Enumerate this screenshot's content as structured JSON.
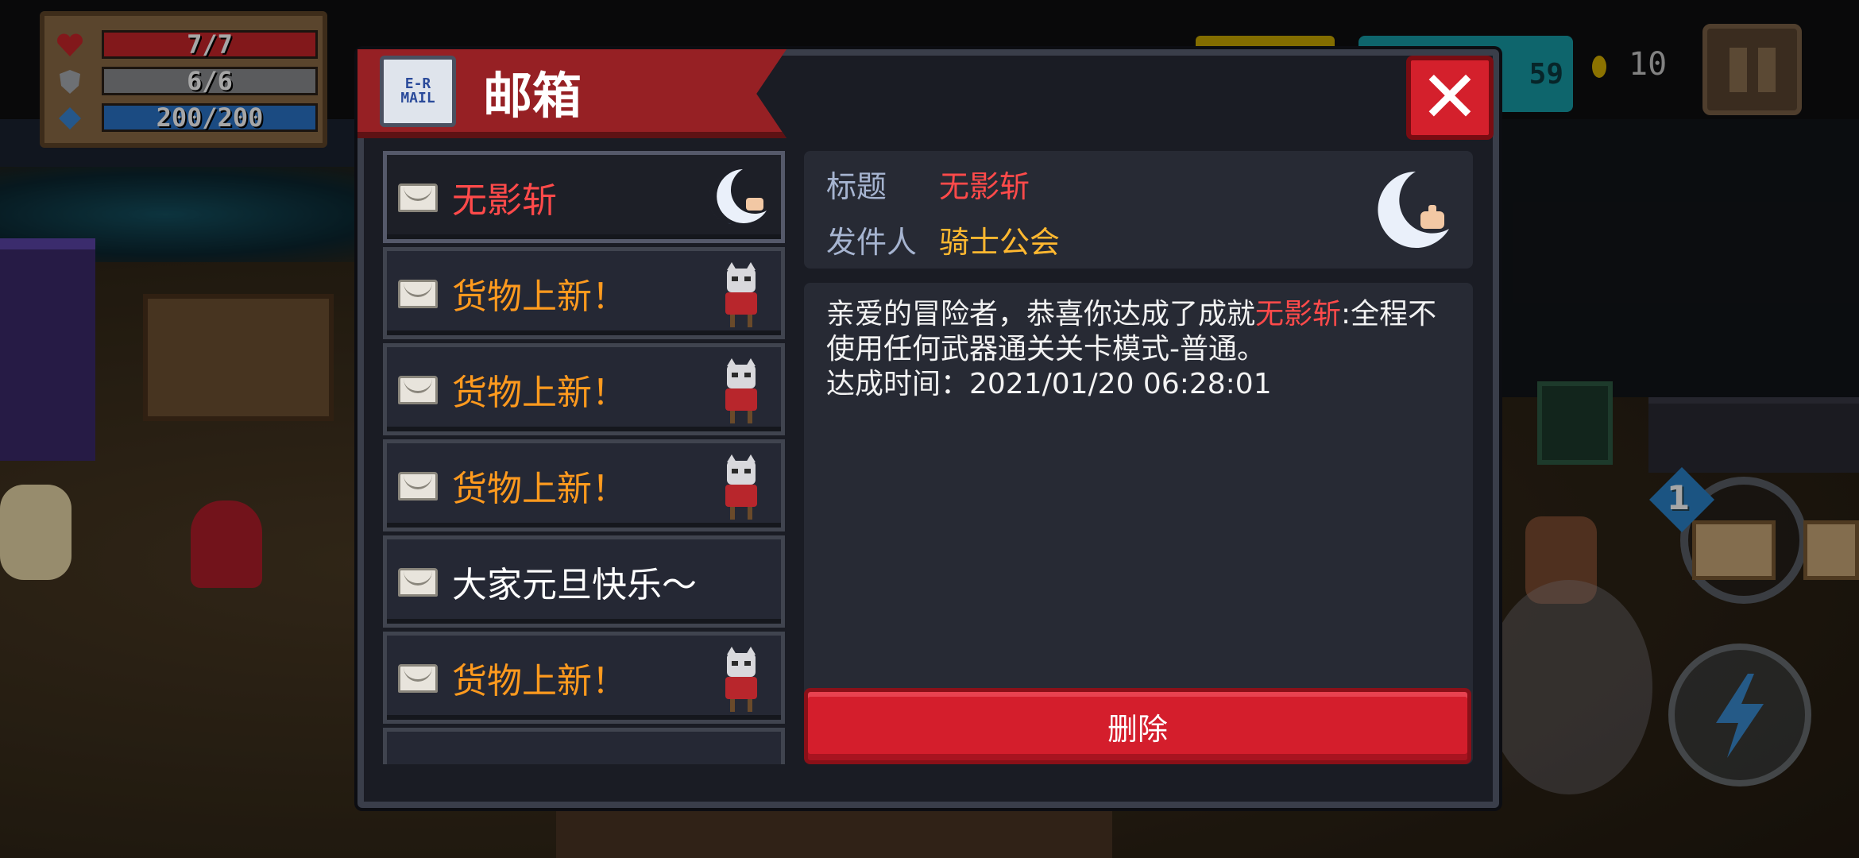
{
  "hud": {
    "hp": "7/7",
    "hp_value": 1.0,
    "armor": "6/6",
    "armor_value": 1.0,
    "energy": "200/200",
    "energy_value": 1.0,
    "gems": "59",
    "coins": "10",
    "weapon_level": "1"
  },
  "dialog": {
    "title": "邮箱",
    "icon_text": "E-R MAIL"
  },
  "mail_list": [
    {
      "label": "无影斩",
      "color": "#ff4a4a",
      "thumb": "crescent-blade-icon",
      "selected": true
    },
    {
      "label": "货物上新！",
      "color": "#ff9a1e",
      "thumb": "merchant-cat-icon",
      "selected": false
    },
    {
      "label": "货物上新！",
      "color": "#ff9a1e",
      "thumb": "merchant-cat-icon",
      "selected": false
    },
    {
      "label": "货物上新！",
      "color": "#ff9a1e",
      "thumb": "merchant-cat-icon",
      "selected": false
    },
    {
      "label": "大家元旦快乐～",
      "color": "#ffffff",
      "thumb": "",
      "selected": false
    },
    {
      "label": "货物上新！",
      "color": "#ff9a1e",
      "thumb": "merchant-cat-icon",
      "selected": false
    }
  ],
  "detail": {
    "subject_key": "标题",
    "subject_value": "无影斩",
    "sender_key": "发件人",
    "sender_value": "骑士公会",
    "body_pre": "亲爱的冒险者，恭喜你达成了成就",
    "body_highlight": "无影斩",
    "body_post": ":全程不使用任何武器通关关卡模式-普通。",
    "body_time": "达成时间：2021/01/20 06:28:01",
    "delete_label": "删除"
  },
  "colors": {
    "highlight_red": "#ff4a4a",
    "sender_orange": "#ffb830",
    "update_orange": "#ff9a1e"
  }
}
